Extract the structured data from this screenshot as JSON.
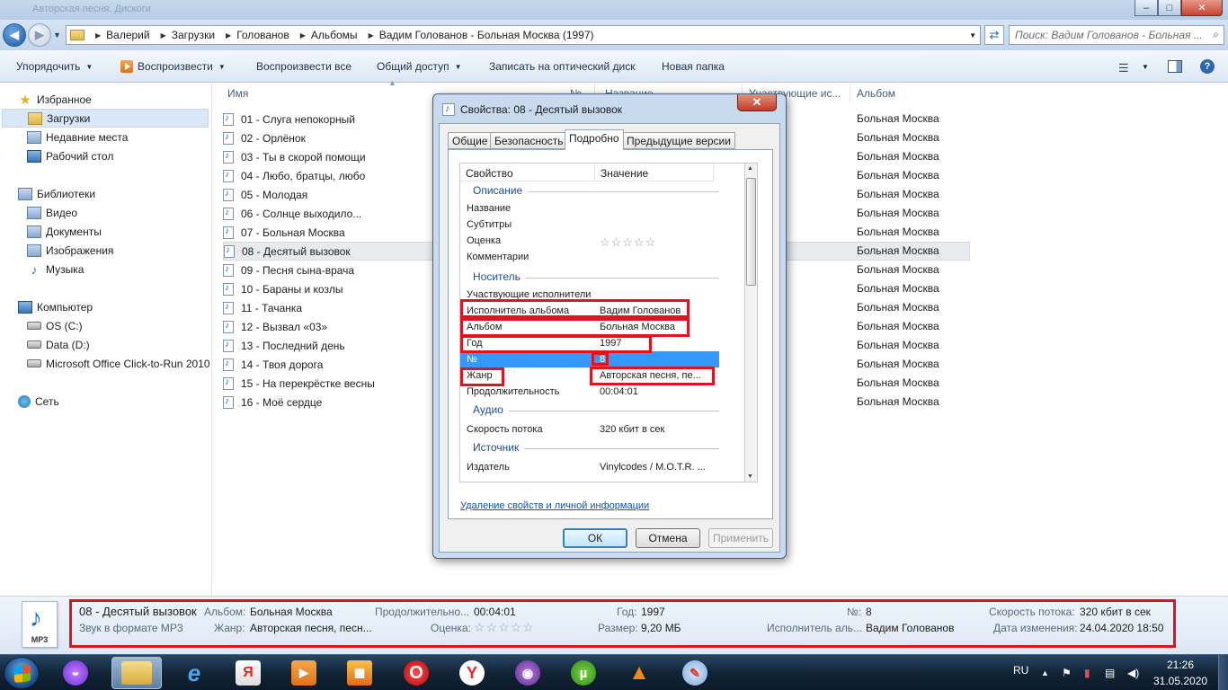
{
  "window": {
    "ghost_title": "Авторская песня. Дискоги",
    "controls": [
      "–",
      "□",
      "✕"
    ]
  },
  "address": {
    "crumbs": [
      "Валерий",
      "Загрузки",
      "Голованов",
      "Альбомы",
      "Вадим Голованов - Больная Москва (1997)"
    ],
    "search_placeholder": "Поиск: Вадим Голованов - Больная ..."
  },
  "toolbar": {
    "organize": "Упорядочить",
    "play": "Воспроизвести",
    "play_all": "Воспроизвести все",
    "share": "Общий доступ",
    "burn": "Записать на оптический диск",
    "new_folder": "Новая папка",
    "help": "?"
  },
  "nav": {
    "favorites": "Избранное",
    "downloads": "Загрузки",
    "recent": "Недавние места",
    "desktop": "Рабочий стол",
    "libraries": "Библиотеки",
    "video": "Видео",
    "documents": "Документы",
    "images": "Изображения",
    "music": "Музыка",
    "computer": "Компьютер",
    "drive_c": "OS (C:)",
    "drive_d": "Data (D:)",
    "office": "Microsoft Office Click-to-Run 2010",
    "network": "Сеть"
  },
  "list": {
    "columns": {
      "name": "Имя",
      "number": "№",
      "title": "Название",
      "artists": "Участвующие ис...",
      "album": "Альбом"
    },
    "files": [
      "01 - Слуга непокорный",
      "02 - Орлёнок",
      "03 - Ты в скорой помощи",
      "04 - Любо, братцы, любо",
      "05 - Молодая",
      "06 - Солнце выходило...",
      "07 - Больная Москва",
      "08 - Десятый вызовок",
      "09 - Песня сына-врача",
      "10 - Бараны и козлы",
      "11 - Тачанка",
      "12 - Вызвал «03»",
      "13 - Последний день",
      "14 - Твоя дорога",
      "15 - На перекрёстке весны",
      "16 - Моё сердце"
    ],
    "album_value": "Больная Москва",
    "selected_index": 7
  },
  "dialog": {
    "title": "Свойства: 08 - Десятый вызовок",
    "close": "✕",
    "tabs": [
      "Общие",
      "Безопасность",
      "Подробно",
      "Предыдущие версии"
    ],
    "active_tab": 2,
    "headers": {
      "property": "Свойство",
      "value": "Значение"
    },
    "groups": {
      "description": "Описание",
      "media": "Носитель",
      "audio": "Аудио",
      "source": "Источник"
    },
    "props": {
      "title": {
        "k": "Название",
        "v": ""
      },
      "subtitle": {
        "k": "Субтитры",
        "v": ""
      },
      "rating": {
        "k": "Оценка",
        "v": "☆☆☆☆☆"
      },
      "comments": {
        "k": "Комментарии",
        "v": ""
      },
      "artists": {
        "k": "Участвующие исполнители",
        "v": ""
      },
      "album_artist": {
        "k": "Исполнитель альбома",
        "v": "Вадим Голованов"
      },
      "album": {
        "k": "Альбом",
        "v": "Больная Москва"
      },
      "year": {
        "k": "Год",
        "v": "1997"
      },
      "number": {
        "k": "№",
        "v": "8"
      },
      "genre": {
        "k": "Жанр",
        "v": "Авторская песня, пе..."
      },
      "duration": {
        "k": "Продолжительность",
        "v": "00:04:01"
      },
      "bitrate": {
        "k": "Скорость потока",
        "v": "320 кбит в сек"
      },
      "publisher": {
        "k": "Издатель",
        "v": "Vinylcodes / M.O.T.R. ..."
      }
    },
    "remove_link": "Удаление свойств и личной информации",
    "ok": "ОК",
    "cancel": "Отмена",
    "apply": "Применить"
  },
  "details": {
    "icon_label": "MP3",
    "file_name": "08 - Десятый вызовок",
    "file_type": "Звук в формате MP3",
    "album_label": "Альбом:",
    "album_value": "Больная Москва",
    "genre_label": "Жанр:",
    "genre_value": "Авторская песня, песн...",
    "duration_label": "Продолжительно...",
    "duration_value": "00:04:01",
    "rating_label": "Оценка:",
    "rating_value": "☆☆☆☆☆",
    "year_label": "Год:",
    "year_value": "1997",
    "size_label": "Размер:",
    "size_value": "9,20 МБ",
    "num_label": "№:",
    "num_value": "8",
    "album_artist_label": "Исполнитель аль...",
    "album_artist_value": "Вадим Голованов",
    "bitrate_label": "Скорость потока:",
    "bitrate_value": "320 кбит в сек",
    "modified_label": "Дата изменения:",
    "modified_value": "24.04.2020 18:50"
  },
  "taskbar": {
    "apps": [
      "alice",
      "explorer",
      "internet-explorer",
      "yandex-browser",
      "media-player",
      "office-installer",
      "opera",
      "yandex",
      "tor-browser",
      "utorrent",
      "vlc",
      "paint"
    ],
    "active": "explorer",
    "lang": "RU",
    "time": "21:26",
    "date": "31.05.2020"
  }
}
